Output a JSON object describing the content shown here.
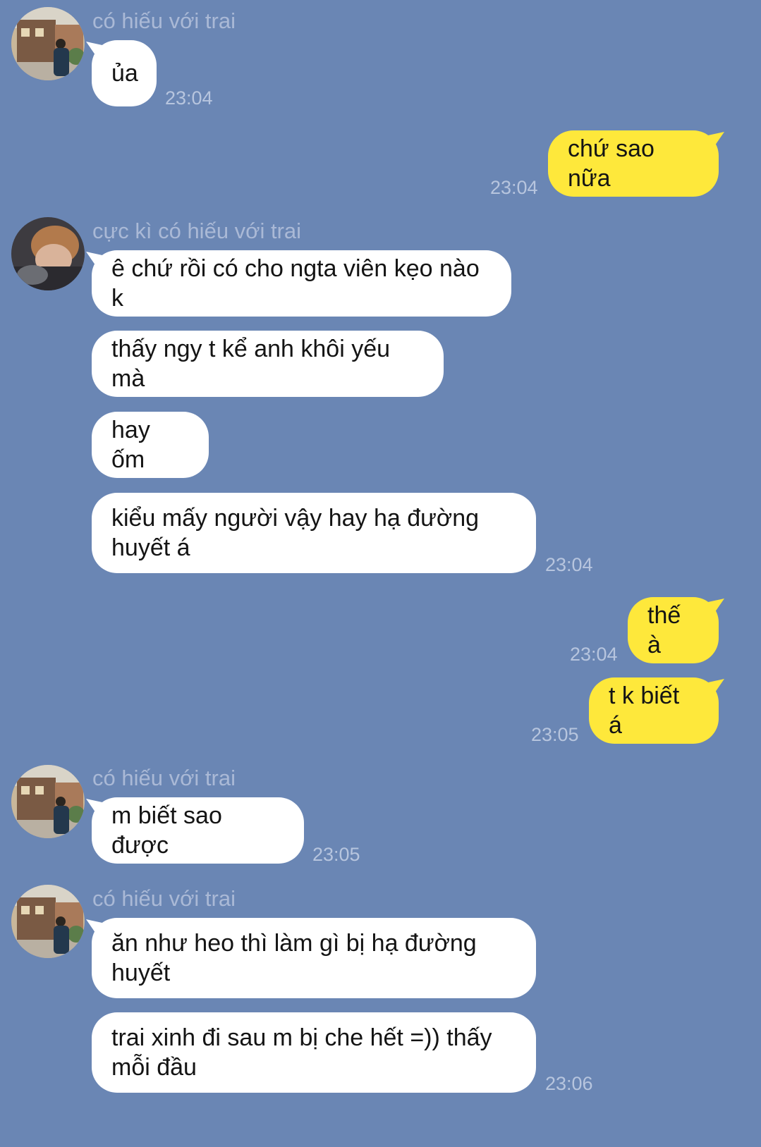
{
  "colors": {
    "background": "#6a86b4",
    "incoming_bubble": "#ffffff",
    "outgoing_bubble": "#fee83b",
    "name_text": "#aab9d6",
    "time_text": "#b7c5de"
  },
  "messages": [
    {
      "sender": "có hiếu với trai",
      "text": "ủa",
      "time": "23:04"
    },
    {
      "text": "chứ sao nữa",
      "time": "23:04"
    },
    {
      "sender": "cực kì có hiếu với trai",
      "text": "ê chứ rồi có cho ngta viên kẹo nào k"
    },
    {
      "text": "thấy ngy t kể anh khôi yếu mà"
    },
    {
      "text": "hay ốm"
    },
    {
      "text": "kiểu mấy người vậy hay hạ đường huyết á",
      "time": "23:04"
    },
    {
      "text": "thế à",
      "time": "23:04"
    },
    {
      "text": "t k biết á",
      "time": "23:05"
    },
    {
      "sender": "có hiếu với trai",
      "text": "m biết sao được",
      "time": "23:05"
    },
    {
      "sender": "có hiếu với trai",
      "text": "ăn như heo thì làm gì bị hạ đường huyết"
    },
    {
      "text": "trai xinh đi sau m bị che hết =)) thấy mỗi đầu",
      "time": "23:06"
    }
  ]
}
